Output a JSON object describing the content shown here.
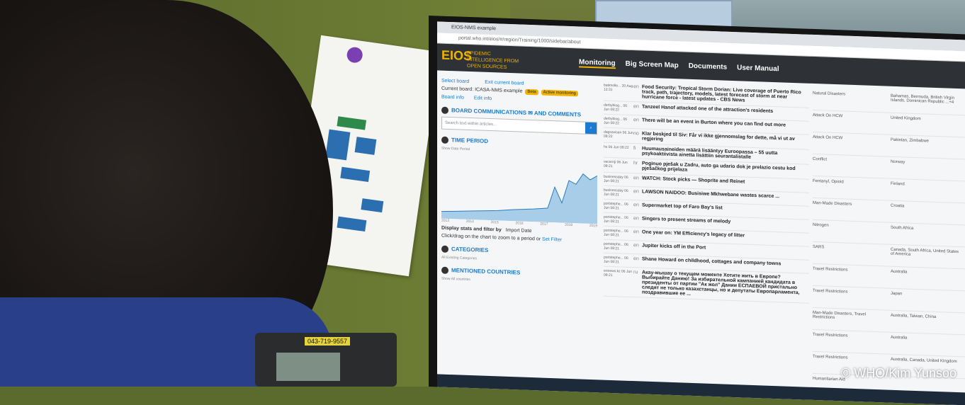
{
  "photo_credit": "© WHO/Kim Yunsoo",
  "browser": {
    "tab": "EIOS-NMS example",
    "url": "portal.who.int/eios/#/region/Training/1000/sidebar/about"
  },
  "app": {
    "logo": "EIOS",
    "logo_sub": "EPIDEMIC INTELLIGENCE FROM OPEN SOURCES",
    "nav": [
      "Monitoring",
      "Big Screen Map",
      "Documents",
      "User Manual"
    ]
  },
  "left_panel": {
    "select_board": "Select board",
    "exit_board": "Exit current board",
    "current_board": "Current board: ICASA-NMS example",
    "badges": [
      "Beta",
      "Active monitoring"
    ],
    "board_info": "Board info",
    "edit_info": "Edit info",
    "board_comms": "BOARD COMMUNICATIONS ✉ AND COMMENTS",
    "search_placeholder": "Search text within articles...",
    "time_period": "TIME PERIOD",
    "time_sub": "Show Date Period",
    "years": [
      "2013",
      "2014",
      "2015",
      "2016",
      "2017",
      "2018",
      "2019"
    ],
    "display_stats": "Display stats and filter by",
    "import_date": "Import Date",
    "click_hint": "Click/drag on the chart to zoom to a period or",
    "set_filter": "Set Filter",
    "categories": "CATEGORIES",
    "categories_sub": "All Existing Categories",
    "mentioned_countries": "MENTIONED COUNTRIES",
    "countries_sub": "Show All countries"
  },
  "articles": [
    {
      "src": "batimolle... 20 Aug 12:31",
      "lang": "en",
      "title": "Food Security: Tropical Storm Dorian: Live coverage of Puerto Rico track, path, trajectory, models, latest forecast of storm at near hurricane force - latest updates - CBS News",
      "category": "Natural Disasters",
      "country": "Bahamas, Bermuda, British Virgin Islands, Dominican Republic ...+4"
    },
    {
      "src": "derbybiog... 06 Jun 08:22",
      "lang": "en",
      "title": "Tanzeel Hanof attacked one of the attraction's residents",
      "category": "Attack On HCW",
      "country": "United Kingdom"
    },
    {
      "src": "derbybiog... 06 Jun 08:22",
      "lang": "en",
      "title": "There will be an event in Burton where you can find out more",
      "category": "Attack On HCW",
      "country": "Pakistan, Zimbabwe"
    },
    {
      "src": "dagsavisen 06 Jun 08:22",
      "lang": "no",
      "title": "Klar beskjed til Siv: Får vi ikke gjennomslag for dette, må vi ut av regjering",
      "category": "Conflict",
      "country": "Norway"
    },
    {
      "src": "hs 06 Jun 08:22",
      "lang": "fi",
      "title": "Huumausaineiden määrä lisääntyy Euroopassa – 55 uutta psykoaktiivista ainetta lisättiin seurantalistalle",
      "category": "Fentanyl, Opioid",
      "country": "Finland"
    },
    {
      "src": "vecernji 06 Jun 08:21",
      "lang": "hr",
      "title": "Poginuo pješak u Zadru, auto ga udario dok je prelazio cestu kod pješačkog prijelaza",
      "category": "Man-Made Disasters",
      "country": "Croatia"
    },
    {
      "src": "businessday 06 Jun 08:21",
      "lang": "en",
      "title": "WATCH: Stock picks — Shoprite and Reinet",
      "category": "Nitrogen",
      "country": "South Africa"
    },
    {
      "src": "businessday 06 Jun 08:21",
      "lang": "en",
      "title": "LAWSON NAIDOO: Busisiwe Mkhwebane wastes scarce ...",
      "category": "SARS",
      "country": "Canada, South Africa, United States of America"
    },
    {
      "src": "portstephe... 06 Jun 08:21",
      "lang": "en",
      "title": "Supermarket top of Faro Bay's list",
      "category": "Travel Restrictions",
      "country": "Australia"
    },
    {
      "src": "portstephe... 06 Jun 08:21",
      "lang": "en",
      "title": "Singers to present streams of melody",
      "category": "Travel Restrictions",
      "country": "Japan"
    },
    {
      "src": "portstephe... 06 Jun 08:21",
      "lang": "en",
      "title": "One year on: YM Efficiency's legacy of litter",
      "category": "Man-Made Disasters, Travel Restrictions",
      "country": "Australia, Taiwan, China"
    },
    {
      "src": "portstephe... 06 Jun 08:21",
      "lang": "en",
      "title": "Jupiter kicks off in the Port",
      "category": "Travel Restrictions",
      "country": "Australia"
    },
    {
      "src": "portstephe... 06 Jun 08:21",
      "lang": "en",
      "title": "Shane Howard on childhood, cottages and company towns",
      "category": "Travel Restrictions",
      "country": "Australia, Canada, United Kingdom"
    },
    {
      "src": "ennews.kz 06 Jun 08:21",
      "lang": "ru",
      "title": "Акау-мышау о текущем моменте Хотите жить в Европе? Выбирайте Данию! За избирательной кампанией кандидата в президенты от партии \"Ак жол\" Дании ЕСПАЕВОЙ пристально следят не только казахстанцы, но и депутаты Европарламента, поздравившие ее ...",
      "category": "Humanitarian Aid",
      "country": ""
    }
  ],
  "poster": {
    "phone_label": "043-719-9557"
  }
}
